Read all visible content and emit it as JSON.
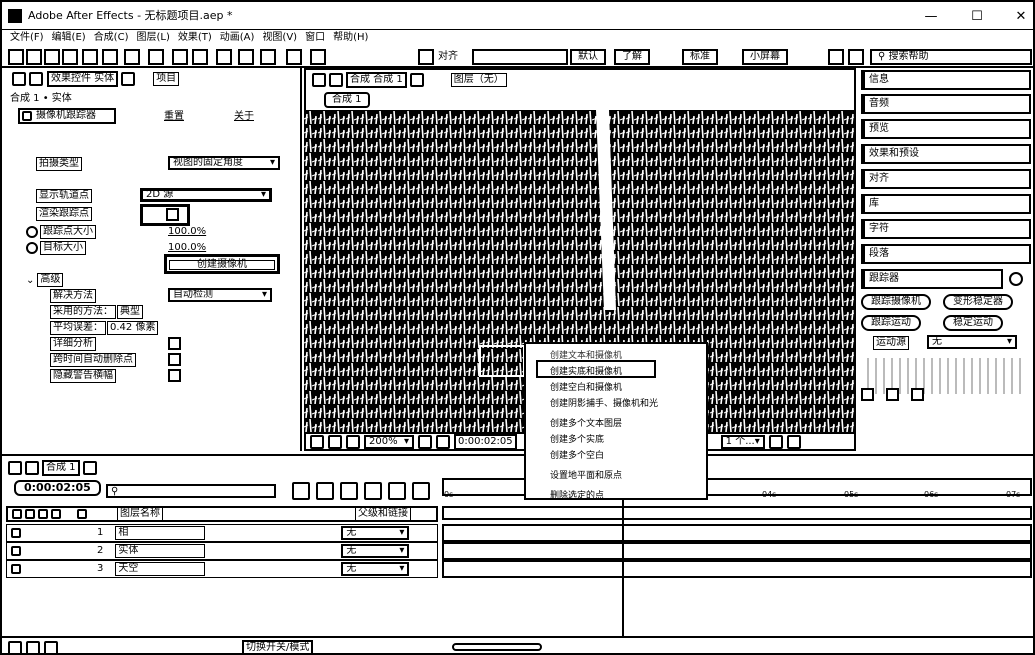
{
  "window": {
    "title": "Adobe After Effects - 无标题项目.aep *",
    "min": "—",
    "max": "☐",
    "close": "✕"
  },
  "menu": [
    "文件(F)",
    "编辑(E)",
    "合成(C)",
    "图层(L)",
    "效果(T)",
    "动画(A)",
    "视图(V)",
    "窗口",
    "帮助(H)"
  ],
  "toolbar": {
    "align": "对齐",
    "workspace": [
      "默认",
      "了解",
      "标准",
      "小屏幕"
    ],
    "search": "搜索帮助"
  },
  "effects_panel": {
    "tab_effects": "效果控件 实体",
    "tab_project": "项目",
    "breadcrumb": "合成 1 • 实体",
    "tracker_name": "摄像机跟踪器",
    "reset": "重置",
    "about": "关于",
    "shot_type_label": "拍摄类型",
    "shot_type_value": "视图的固定角度",
    "show_track_points": "显示轨道点",
    "show_track_points_value": "2D 源",
    "render_track_points": "渲染跟踪点",
    "track_point_size": "跟踪点大小",
    "track_point_size_value": "100.0%",
    "target_size": "目标大小",
    "target_size_value": "100.0%",
    "create_camera": "创建摄像机",
    "advanced": "高级",
    "solve_method": "解决方法",
    "solve_method_value": "自动检测",
    "method_used": "采用的方法：",
    "method_used_value": "典型",
    "avg_error": "平均误差：",
    "avg_error_value": "0.42 像素",
    "detailed_analysis": "详细分析",
    "auto_delete": "跨时间自动删除点",
    "hide_warning": "隐藏警告横幅"
  },
  "viewer": {
    "tab": "合成 合成 1",
    "layer_tab": "图层（无）",
    "comp_label": "合成 1",
    "zoom": "200%",
    "timecode": "0:00:02:05",
    "camera": "1 个..."
  },
  "right_panel": {
    "items": [
      "信息",
      "音频",
      "预览",
      "效果和预设",
      "对齐",
      "库",
      "字符",
      "段落"
    ],
    "tracker": "跟踪器",
    "track_camera": "跟踪摄像机",
    "warp_stabilizer": "变形稳定器",
    "track_motion": "跟踪运动",
    "stabilize_motion": "稳定运动",
    "motion_source": "运动源",
    "motion_source_value": "无"
  },
  "timeline": {
    "comp_tab": "合成 1",
    "timecode": "0:00:02:05",
    "search_icon": "search-icon",
    "col_layer_name": "图层名称",
    "col_parent": "父级和链接",
    "layers": [
      {
        "num": "1",
        "name": "相",
        "parent": "无"
      },
      {
        "num": "2",
        "name": "实体",
        "parent": "无"
      },
      {
        "num": "3",
        "name": "天空",
        "parent": "无"
      }
    ],
    "ruler": [
      "0s",
      "04s",
      "05s",
      "06s",
      "07s"
    ],
    "toggle": "切换开关/模式"
  },
  "context_menu": [
    "创建文本和摄像机",
    "创建实底和摄像机",
    "创建空白和摄像机",
    "创建阴影捕手、摄像机和光",
    "创建多个文本图层",
    "创建多个实底",
    "创建多个空白",
    "设置地平面和原点",
    "删除选定的点"
  ]
}
